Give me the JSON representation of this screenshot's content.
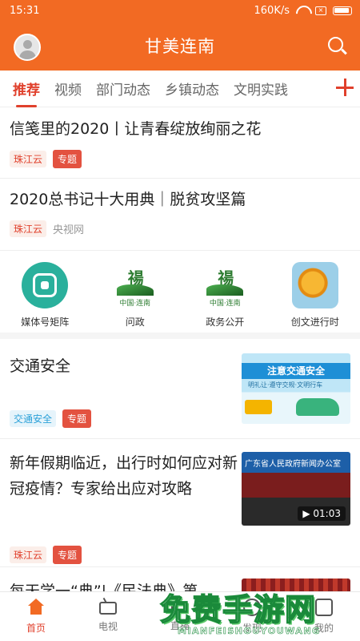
{
  "status_bar": {
    "time": "15:31",
    "speed": "160K/s"
  },
  "header": {
    "title": "甘美连南"
  },
  "tabs": [
    {
      "label": "推荐",
      "active": true
    },
    {
      "label": "视频"
    },
    {
      "label": "部门动态"
    },
    {
      "label": "乡镇动态"
    },
    {
      "label": "文明实践"
    }
  ],
  "articles": [
    {
      "title": "信笺里的2020丨让青春绽放绚丽之花",
      "source_tag": "珠江云",
      "topic_tag": "专题"
    },
    {
      "title": "2020总书记十大用典｜脱贫攻坚篇",
      "source_tag": "珠江云",
      "source_name": "央视网"
    },
    {
      "title": "交通安全",
      "source_tag": "交通安全",
      "topic_tag": "专题",
      "thumb_banner": "注意交通安全",
      "thumb_sub": "明礼让·遵守交规·文明行车"
    },
    {
      "title": "新年假期临近，出行时如何应对新冠疫情？专家给出应对攻略",
      "source_tag": "珠江云",
      "topic_tag": "专题",
      "thumb_caption": "广东省人民政府新闻办公室",
      "duration": "01:03"
    },
    {
      "title": "每天学一“典”|《民法典》第"
    }
  ],
  "quick_links": [
    {
      "label": "媒体号矩阵",
      "icon": "media-matrix-icon"
    },
    {
      "label": "问政",
      "icon": "lian-nan-logo-icon",
      "logo_text": "中国·连南"
    },
    {
      "label": "政务公开",
      "icon": "lian-nan-logo-icon",
      "logo_text": "中国·连南"
    },
    {
      "label": "创文进行时",
      "icon": "sunflower-icon"
    }
  ],
  "bottom_nav": [
    {
      "label": "首页",
      "icon": "home-icon",
      "active": true
    },
    {
      "label": "电视",
      "icon": "tv-icon"
    },
    {
      "label": "直播",
      "icon": "camera-icon"
    },
    {
      "label": "发现",
      "icon": "compass-icon"
    },
    {
      "label": "我的",
      "icon": "grid-icon"
    }
  ],
  "watermark": {
    "text": "免费手游网",
    "sub": "MIANFEISHOUYOUWANG"
  },
  "colors": {
    "brand": "#f26a23",
    "accent": "#e0402c"
  }
}
